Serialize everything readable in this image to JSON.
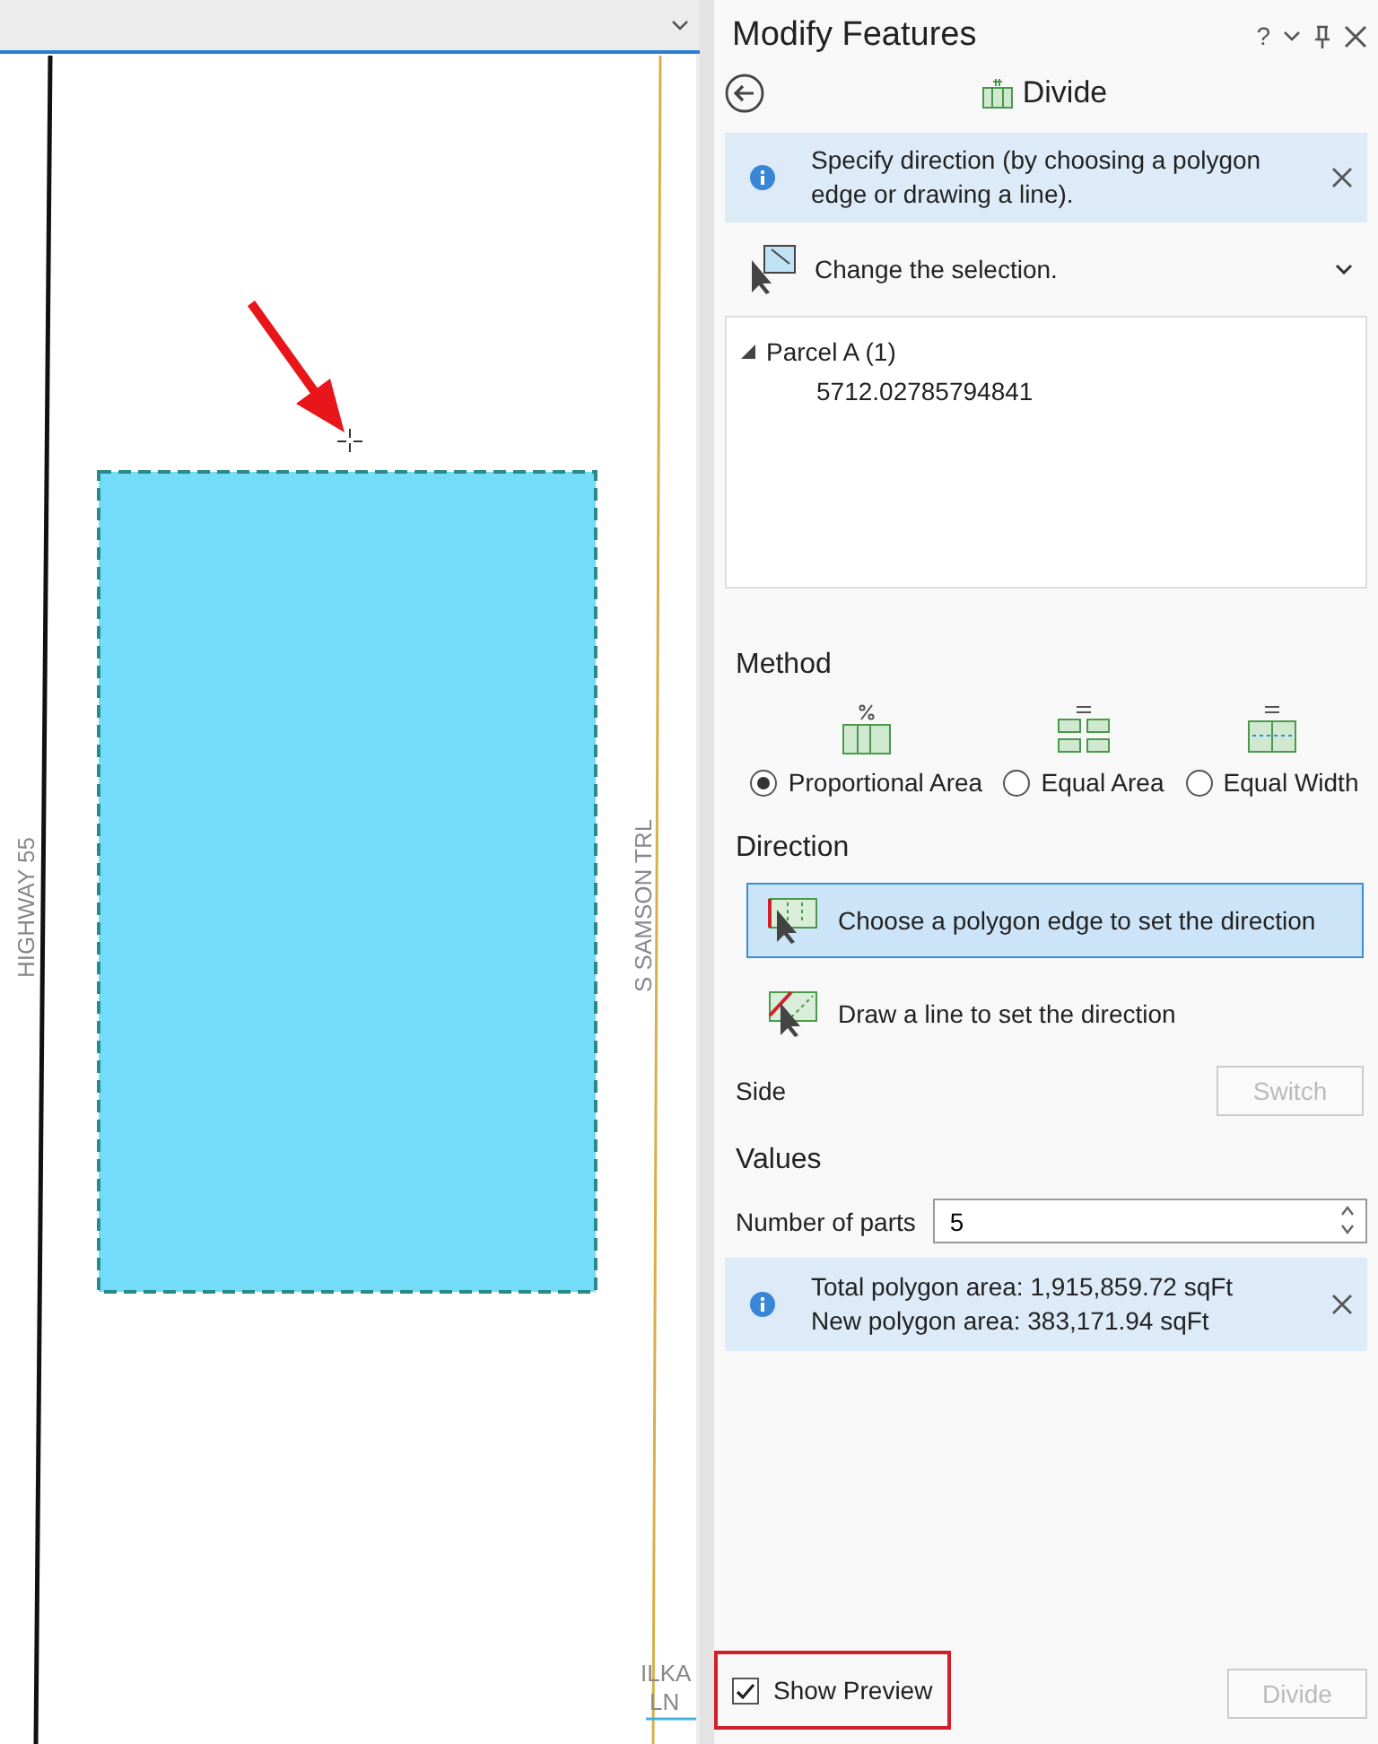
{
  "map": {
    "highway_label": "HIGHWAY 55",
    "street_label": "S SAMSON TRL",
    "corner_label": [
      "ILKA",
      "LN"
    ]
  },
  "panel": {
    "title": "Modify Features",
    "help": "?",
    "tool": "Divide",
    "message": "Specify direction (by choosing a polygon edge or drawing a line).",
    "selection_prompt": "Change the selection.",
    "tree": [
      {
        "label": "Parcel A (1)",
        "expanded": true,
        "children": [
          {
            "label": "5712.02785794841"
          }
        ]
      }
    ],
    "method": {
      "heading": "Method",
      "options": [
        {
          "label": "Proportional Area",
          "kind": "proportional",
          "selected": true
        },
        {
          "label": "Equal Area",
          "kind": "area",
          "selected": false
        },
        {
          "label": "Equal Width",
          "kind": "width",
          "selected": false
        }
      ]
    },
    "direction": {
      "heading": "Direction",
      "options": [
        {
          "label": "Choose a polygon edge to set the direction",
          "kind": "edge",
          "selected": true
        },
        {
          "label": "Draw a line to set the direction",
          "kind": "line",
          "selected": false
        }
      ],
      "side_label": "Side",
      "switch_button": {
        "label": "Switch",
        "disabled": true
      }
    },
    "values": {
      "heading": "Values",
      "parts_label": "Number of parts",
      "parts_value": "5",
      "info": [
        "Total polygon area: 1,915,859.72 sqFt",
        "New polygon area: 383,171.94 sqFt"
      ]
    },
    "show_preview": {
      "label": "Show Preview",
      "checked": true,
      "highlighted": true
    },
    "divide_button": {
      "label": "Divide",
      "disabled": true
    }
  }
}
